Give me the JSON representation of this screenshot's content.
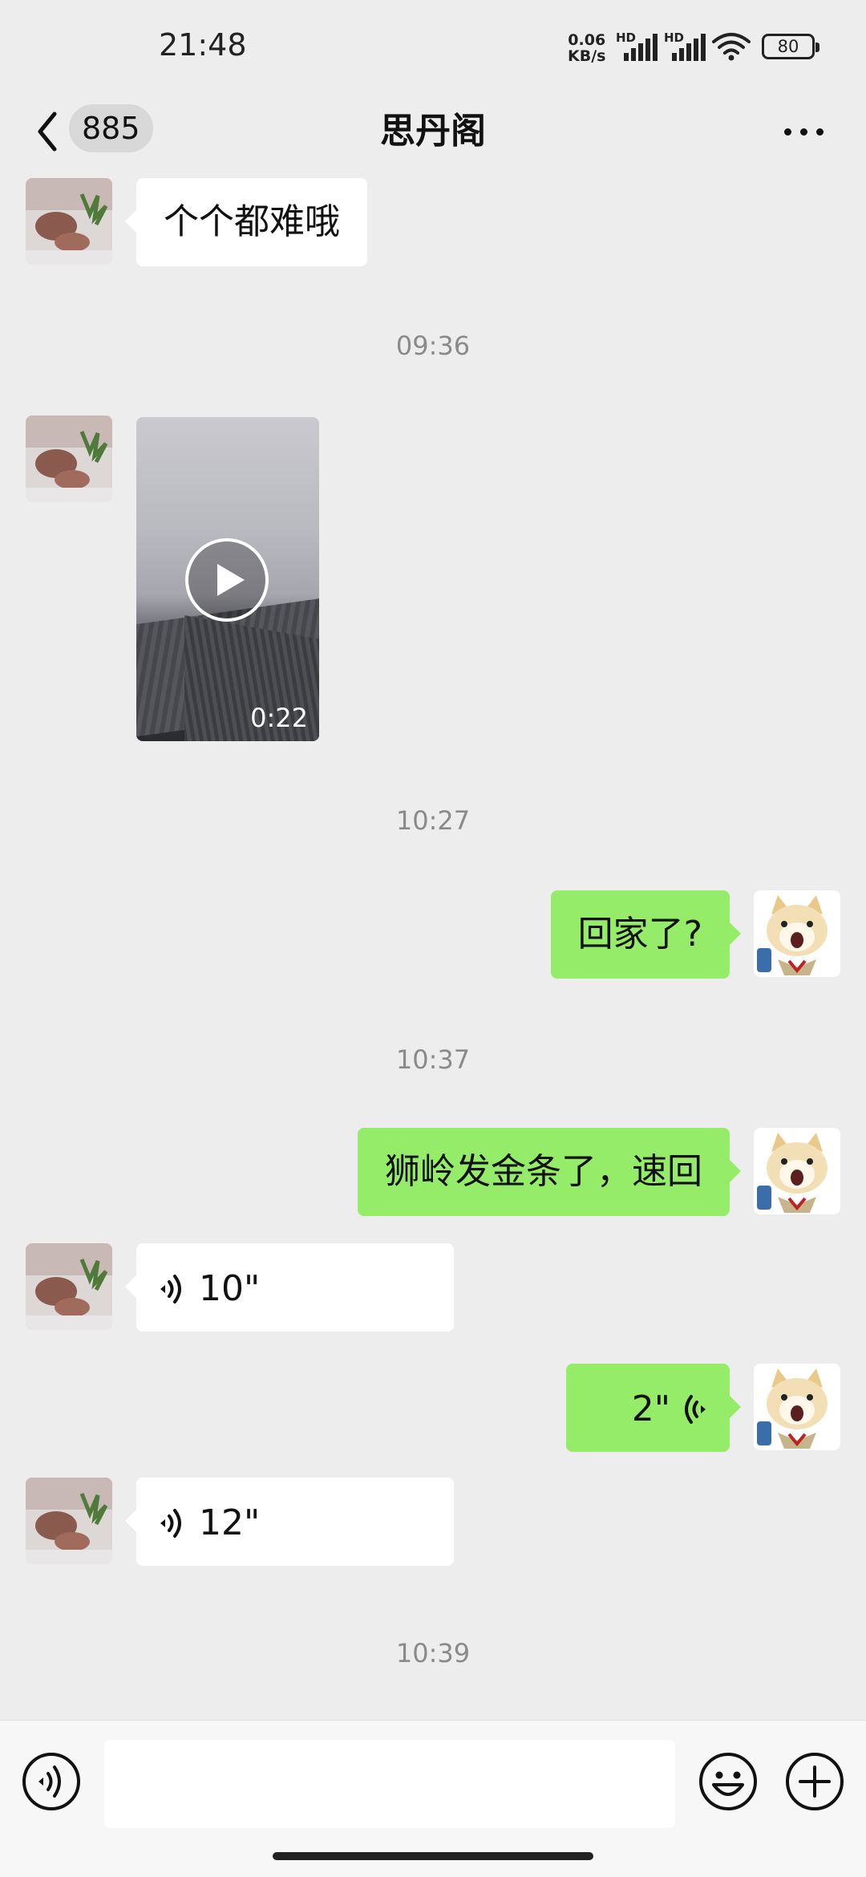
{
  "status_bar": {
    "time": "21:48",
    "net_speed_value": "0.06",
    "net_speed_unit": "KB/s",
    "sim1_label": "HD",
    "sim2_label": "HD",
    "battery": "80"
  },
  "header": {
    "unread_count": "885",
    "title": "思丹阁"
  },
  "messages": [
    {
      "side": "left",
      "type": "text",
      "text": "个个都难哦"
    },
    {
      "type": "time",
      "text": "09:36"
    },
    {
      "side": "left",
      "type": "video",
      "duration": "0:22"
    },
    {
      "type": "time",
      "text": "10:27"
    },
    {
      "side": "right",
      "type": "text",
      "text": "回家了?"
    },
    {
      "type": "time",
      "text": "10:37"
    },
    {
      "side": "right",
      "type": "text",
      "text": "狮岭发金条了，速回"
    },
    {
      "side": "left",
      "type": "voice",
      "duration": "10\""
    },
    {
      "side": "right",
      "type": "voice",
      "duration": "2\""
    },
    {
      "side": "left",
      "type": "voice",
      "duration": "12\""
    },
    {
      "type": "time",
      "text": "10:39"
    }
  ],
  "input": {
    "value": "",
    "placeholder": ""
  },
  "colors": {
    "background": "#ededed",
    "bubble_sent": "#95ec69",
    "bubble_received": "#ffffff",
    "timestamp": "#8a8a8a"
  },
  "icons": [
    "back-icon",
    "more-icon",
    "play-icon",
    "voice-icon",
    "emoji-icon",
    "plus-icon",
    "wifi-icon",
    "battery-icon"
  ]
}
